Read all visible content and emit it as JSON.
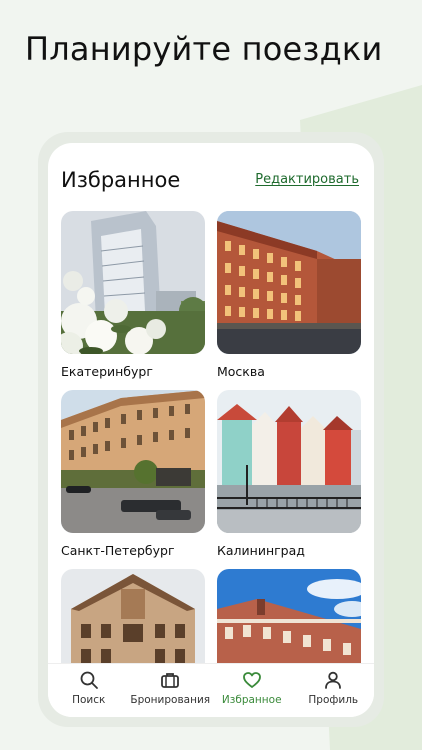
{
  "headline": "Планируйте поездки",
  "favorites": {
    "title": "Избранное",
    "edit_label": "Редактировать",
    "cities": [
      {
        "name": "Екатеринбург"
      },
      {
        "name": "Москва"
      },
      {
        "name": "Санкт-Петербург"
      },
      {
        "name": "Калининград"
      },
      {
        "name": ""
      },
      {
        "name": ""
      }
    ]
  },
  "tabs": [
    {
      "label": "Поиск",
      "icon": "search-icon"
    },
    {
      "label": "Бронирования",
      "icon": "briefcase-icon"
    },
    {
      "label": "Избранное",
      "icon": "heart-icon",
      "active": true
    },
    {
      "label": "Профиль",
      "icon": "person-icon"
    }
  ],
  "colors": {
    "accent": "#3a8a3a",
    "link": "#1f6b2e",
    "background": "#f1f5f0"
  }
}
